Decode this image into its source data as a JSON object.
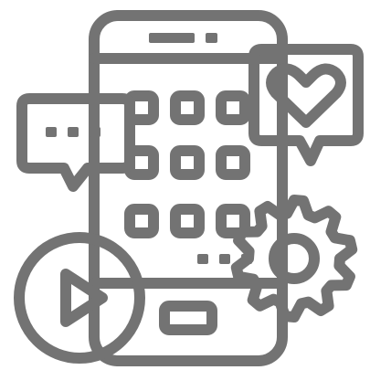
{
  "icon": {
    "name": "mobile-app-social-icon",
    "stroke_color": "#737373",
    "fill_color": "#737373",
    "background": "#ffffff",
    "parts": [
      "phone",
      "chat-bubble",
      "heart-bubble",
      "gear",
      "play-button",
      "app-grid",
      "home-button",
      "speaker-slot"
    ]
  }
}
